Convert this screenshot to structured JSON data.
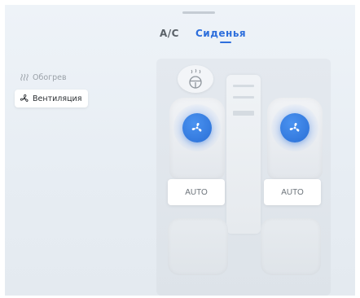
{
  "tabs": {
    "ac": "A/C",
    "seats": "Сиденья",
    "active": "seats"
  },
  "sidebar": {
    "heating": {
      "label": "Обогрев",
      "icon": "heat-waves-icon",
      "selected": false
    },
    "ventilation": {
      "label": "Вентиляция",
      "icon": "fan-icon",
      "selected": true
    }
  },
  "seats": {
    "driver": {
      "auto_label": "AUTO",
      "icon": "fan-icon",
      "ventilation_on": true
    },
    "passenger": {
      "auto_label": "AUTO",
      "icon": "fan-icon",
      "ventilation_on": true
    }
  },
  "colors": {
    "accent": "#2e6fdc",
    "fan_active": "#3a84ea"
  }
}
